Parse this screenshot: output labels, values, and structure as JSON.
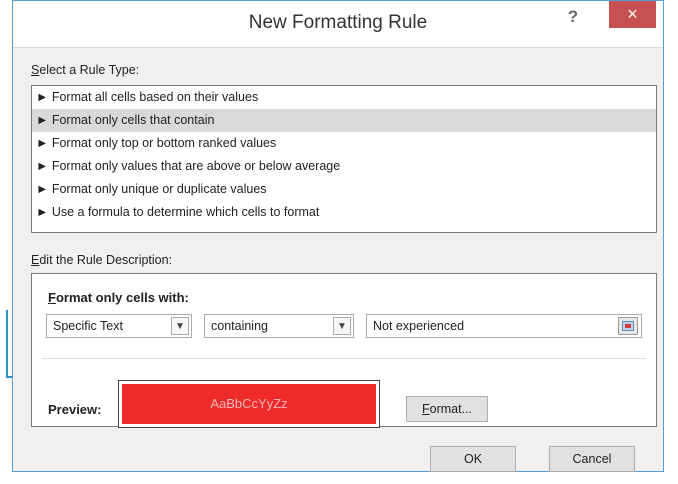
{
  "dialog": {
    "title": "New Formatting Rule",
    "help_glyph": "?",
    "close_glyph": "×"
  },
  "rule_type": {
    "label_prefix": "S",
    "label_rest": "elect a Rule Type:",
    "items": [
      {
        "label": "► Format all cells based on their values"
      },
      {
        "label": "► Format only cells that contain"
      },
      {
        "label": "► Format only top or bottom ranked values"
      },
      {
        "label": "► Format only values that are above or below average"
      },
      {
        "label": "► Format only unique or duplicate values"
      },
      {
        "label": "► Use a formula to determine which cells to format"
      }
    ],
    "selected_index": 1
  },
  "rule_description": {
    "label_prefix": "E",
    "label_rest": "dit the Rule Description:",
    "format_only_prefix": "F",
    "format_only_rest": "ormat only cells with:",
    "condition_type": "Specific Text",
    "operator": "containing",
    "value": "Not experienced",
    "preview_label": "Preview:",
    "preview_sample": "AaBbCcYyZz",
    "format_button_prefix": "F",
    "format_button_rest": "ormat...",
    "preview_fill_color": "#ee2a2a"
  },
  "footer": {
    "ok_label": "OK",
    "cancel_label": "Cancel"
  },
  "icons": {
    "dropdown_glyph": "▼",
    "range_selector": "cell-range-icon"
  },
  "colors": {
    "accent_arrow": "#2f8fd0",
    "close_button": "#c75050"
  }
}
